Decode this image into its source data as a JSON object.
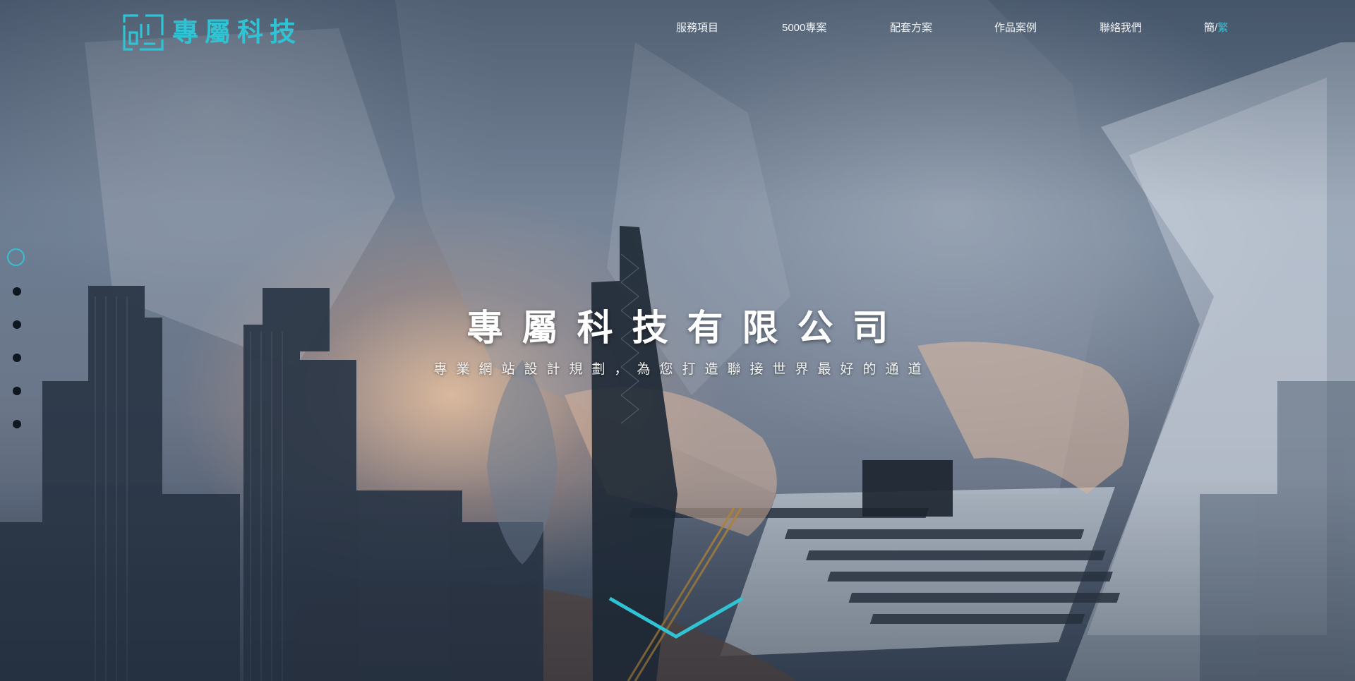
{
  "brand": {
    "name": "專屬科技",
    "accent_color": "#2fc3d3",
    "logo_icon": "logo-mark-icon"
  },
  "nav": {
    "items": [
      {
        "label": "服務項目"
      },
      {
        "label": "5000專案"
      },
      {
        "label": "配套方案"
      },
      {
        "label": "作品案例"
      },
      {
        "label": "聯絡我們"
      }
    ],
    "lang": {
      "simplified": "簡",
      "separator": "/",
      "traditional": "繁",
      "active": "traditional"
    }
  },
  "section_nav": {
    "count": 6,
    "active_index": 0
  },
  "hero": {
    "title": "專屬科技有限公司",
    "subtitle": "專業網站設計規劃，為您打造聯接世界最好的通道",
    "scroll_icon": "chevron-down-icon"
  }
}
